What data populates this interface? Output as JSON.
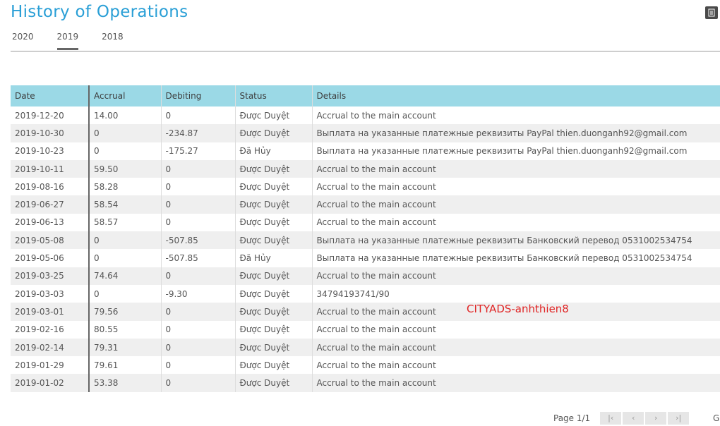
{
  "header": {
    "title": "History of Operations"
  },
  "tabs": [
    {
      "label": "2020",
      "active": false
    },
    {
      "label": "2019",
      "active": true
    },
    {
      "label": "2018",
      "active": false
    }
  ],
  "table": {
    "columns": [
      "Date",
      "Accrual",
      "Debiting",
      "Status",
      "Details"
    ],
    "rows": [
      [
        "2019-12-20",
        "14.00",
        "0",
        "Được Duyệt",
        "Accrual to the main account"
      ],
      [
        "2019-10-30",
        "0",
        "-234.87",
        "Được Duyệt",
        "Выплата на указанные платежные реквизиты PayPal thien.duonganh92@gmail.com"
      ],
      [
        "2019-10-23",
        "0",
        "-175.27",
        "Đã Hủy",
        "Выплата на указанные платежные реквизиты PayPal thien.duonganh92@gmail.com"
      ],
      [
        "2019-10-11",
        "59.50",
        "0",
        "Được Duyệt",
        "Accrual to the main account"
      ],
      [
        "2019-08-16",
        "58.28",
        "0",
        "Được Duyệt",
        "Accrual to the main account"
      ],
      [
        "2019-06-27",
        "58.54",
        "0",
        "Được Duyệt",
        "Accrual to the main account"
      ],
      [
        "2019-06-13",
        "58.57",
        "0",
        "Được Duyệt",
        "Accrual to the main account"
      ],
      [
        "2019-05-08",
        "0",
        "-507.85",
        "Được Duyệt",
        "Выплата на указанные платежные реквизиты Банковский перевод 0531002534754"
      ],
      [
        "2019-05-06",
        "0",
        "-507.85",
        "Đã Hủy",
        "Выплата на указанные платежные реквизиты Банковский перевод 0531002534754"
      ],
      [
        "2019-03-25",
        "74.64",
        "0",
        "Được Duyệt",
        "Accrual to the main account"
      ],
      [
        "2019-03-03",
        "0",
        "-9.30",
        "Được Duyệt",
        "34794193741/90"
      ],
      [
        "2019-03-01",
        "79.56",
        "0",
        "Được Duyệt",
        "Accrual to the main account"
      ],
      [
        "2019-02-16",
        "80.55",
        "0",
        "Được Duyệt",
        "Accrual to the main account"
      ],
      [
        "2019-02-14",
        "79.31",
        "0",
        "Được Duyệt",
        "Accrual to the main account"
      ],
      [
        "2019-01-29",
        "79.61",
        "0",
        "Được Duyệt",
        "Accrual to the main account"
      ],
      [
        "2019-01-02",
        "53.38",
        "0",
        "Được Duyệt",
        "Accrual to the main account"
      ]
    ]
  },
  "watermark": {
    "text": "CITYADS-anhthien8",
    "color": "#e02424"
  },
  "pagination": {
    "label": "Page 1/1",
    "buttons": [
      {
        "name": "first-page-icon",
        "glyph": "|‹"
      },
      {
        "name": "prev-page-icon",
        "glyph": "‹"
      },
      {
        "name": "next-page-icon",
        "glyph": "›"
      },
      {
        "name": "last-page-icon",
        "glyph": "›|"
      }
    ],
    "trail": "G"
  },
  "colors": {
    "accent": "#2a9fd6",
    "header_bg": "#9bd9e6",
    "row_alt": "#efefef"
  }
}
